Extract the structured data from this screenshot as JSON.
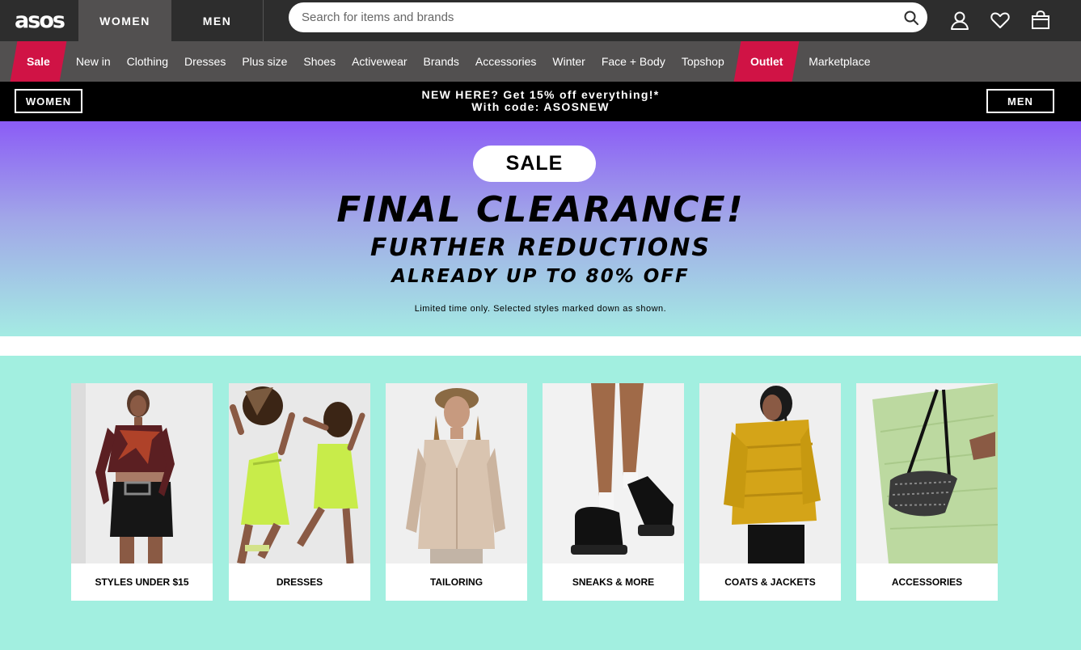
{
  "header": {
    "logo": "asos",
    "gender_tabs": [
      "WOMEN",
      "MEN"
    ],
    "search_placeholder": "Search for items and brands",
    "icons": [
      "search-icon",
      "account-icon",
      "heart-icon",
      "bag-icon"
    ]
  },
  "nav": {
    "items": [
      {
        "label": "Sale",
        "highlight": true
      },
      {
        "label": "New in"
      },
      {
        "label": "Clothing"
      },
      {
        "label": "Dresses"
      },
      {
        "label": "Plus size"
      },
      {
        "label": "Shoes"
      },
      {
        "label": "Activewear"
      },
      {
        "label": "Brands"
      },
      {
        "label": "Accessories"
      },
      {
        "label": "Winter"
      },
      {
        "label": "Face + Body"
      },
      {
        "label": "Topshop"
      },
      {
        "label": "Outlet",
        "highlight": true
      },
      {
        "label": "Marketplace"
      }
    ]
  },
  "promo": {
    "left_button": "WOMEN",
    "line1": "NEW HERE? Get 15% off everything!*",
    "line2": "With code: ASOSNEW",
    "right_button": "MEN"
  },
  "hero": {
    "badge": "SALE",
    "headline": "FINAL CLEARANCE!",
    "subhead": "FURTHER REDUCTIONS",
    "subhead2": "ALREADY UP TO 80% OFF",
    "note": "Limited time only. Selected styles marked down as shown."
  },
  "tiles": [
    {
      "label": "STYLES UNDER $15"
    },
    {
      "label": "DRESSES"
    },
    {
      "label": "TAILORING"
    },
    {
      "label": "SNEAKS & MORE"
    },
    {
      "label": "COATS & JACKETS"
    },
    {
      "label": "ACCESSORIES"
    }
  ],
  "colors": {
    "header_bg": "#2d2d2d",
    "nav_bg": "#525050",
    "sale_red": "#d01345",
    "hero_top": "#8b5cf6",
    "hero_bottom": "#a4ebe3",
    "tiles_bg": "#a2efe0"
  }
}
